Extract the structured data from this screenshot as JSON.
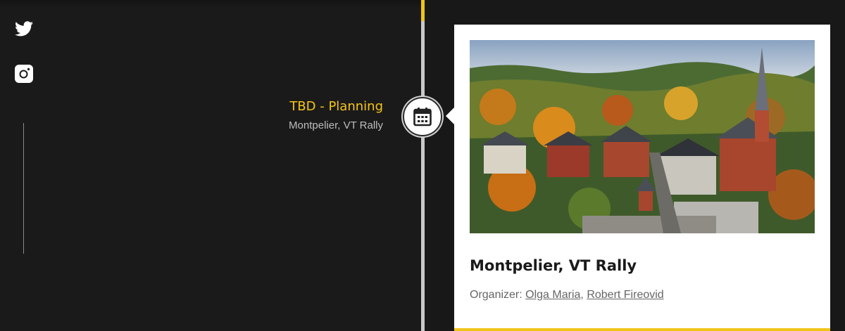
{
  "social": {
    "twitter_icon": "twitter-icon",
    "instagram_icon": "instagram-icon"
  },
  "colors": {
    "accent": "#f0c419",
    "background": "#1b1a1a",
    "card": "#ffffff"
  },
  "event": {
    "date_status": "TBD - Planning",
    "location": "Montpelier, VT Rally",
    "badge_icon": "calendar-icon",
    "card": {
      "image_alt": "Montpelier town aerial view with autumn foliage and church steeple",
      "title": "Montpelier, VT Rally",
      "organizer_label": "Organizer:",
      "organizers": [
        "Olga Maria",
        "Robert Fireovid"
      ],
      "separator": ","
    }
  }
}
